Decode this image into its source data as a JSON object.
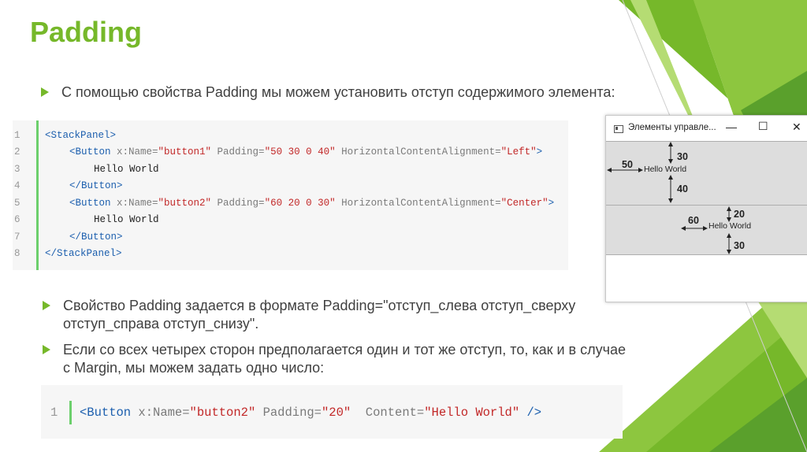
{
  "slide": {
    "title": "Padding",
    "bullets": [
      "С помощью свойства Padding мы можем установить отступ содержимого элемента:",
      "Свойство Padding задается в формате Padding=\"отступ_слева отступ_сверху отступ_справа отступ_снизу\".",
      "Если со всех четырех сторон предполагается один и тот же отступ, то, как и в случае с Margin, мы можем задать одно число:"
    ]
  },
  "code1": {
    "line_numbers": [
      "1",
      "2",
      "3",
      "4",
      "5",
      "6",
      "7",
      "8"
    ],
    "lines": [
      {
        "t1": "<StackPanel>"
      },
      {
        "t1": "<Button ",
        "a1": "x:Name=",
        "s1": "\"button1\"",
        "a2": " Padding=",
        "s2": "\"50 30 0 40\"",
        "a3": " HorizontalContentAlignment=",
        "s3": "\"Left\"",
        "t2": ">"
      },
      {
        "p": "Hello World"
      },
      {
        "t1": "</Button>"
      },
      {
        "t1": "<Button ",
        "a1": "x:Name=",
        "s1": "\"button2\"",
        "a2": " Padding=",
        "s2": "\"60 20 0 30\"",
        "a3": " HorizontalContentAlignment=",
        "s3": "\"Center\"",
        "t2": ">"
      },
      {
        "p": "Hello World"
      },
      {
        "t1": "</Button>"
      },
      {
        "t1": "</StackPanel>"
      }
    ]
  },
  "code2": {
    "line_number": "1",
    "t1": "<Button ",
    "a1": "x:Name=",
    "s1": "\"button2\"",
    "a2": " Padding=",
    "s2": "\"20\"",
    "a3": "  Content=",
    "s3": "\"Hello World\"",
    "t2": " />"
  },
  "window": {
    "title": "Элементы управле...",
    "minimize": "—",
    "maximize": "☐",
    "close": "✕",
    "button1": {
      "content": "Hello World",
      "pad_left": "50",
      "pad_top": "30",
      "pad_bottom": "40"
    },
    "button2": {
      "content": "Hello World",
      "pad_left": "60",
      "pad_top": "20",
      "pad_bottom": "30"
    }
  },
  "colors": {
    "accent": "#76b82a",
    "tag": "#1c5fae",
    "string": "#c22828",
    "attr": "#7a7a7a"
  }
}
